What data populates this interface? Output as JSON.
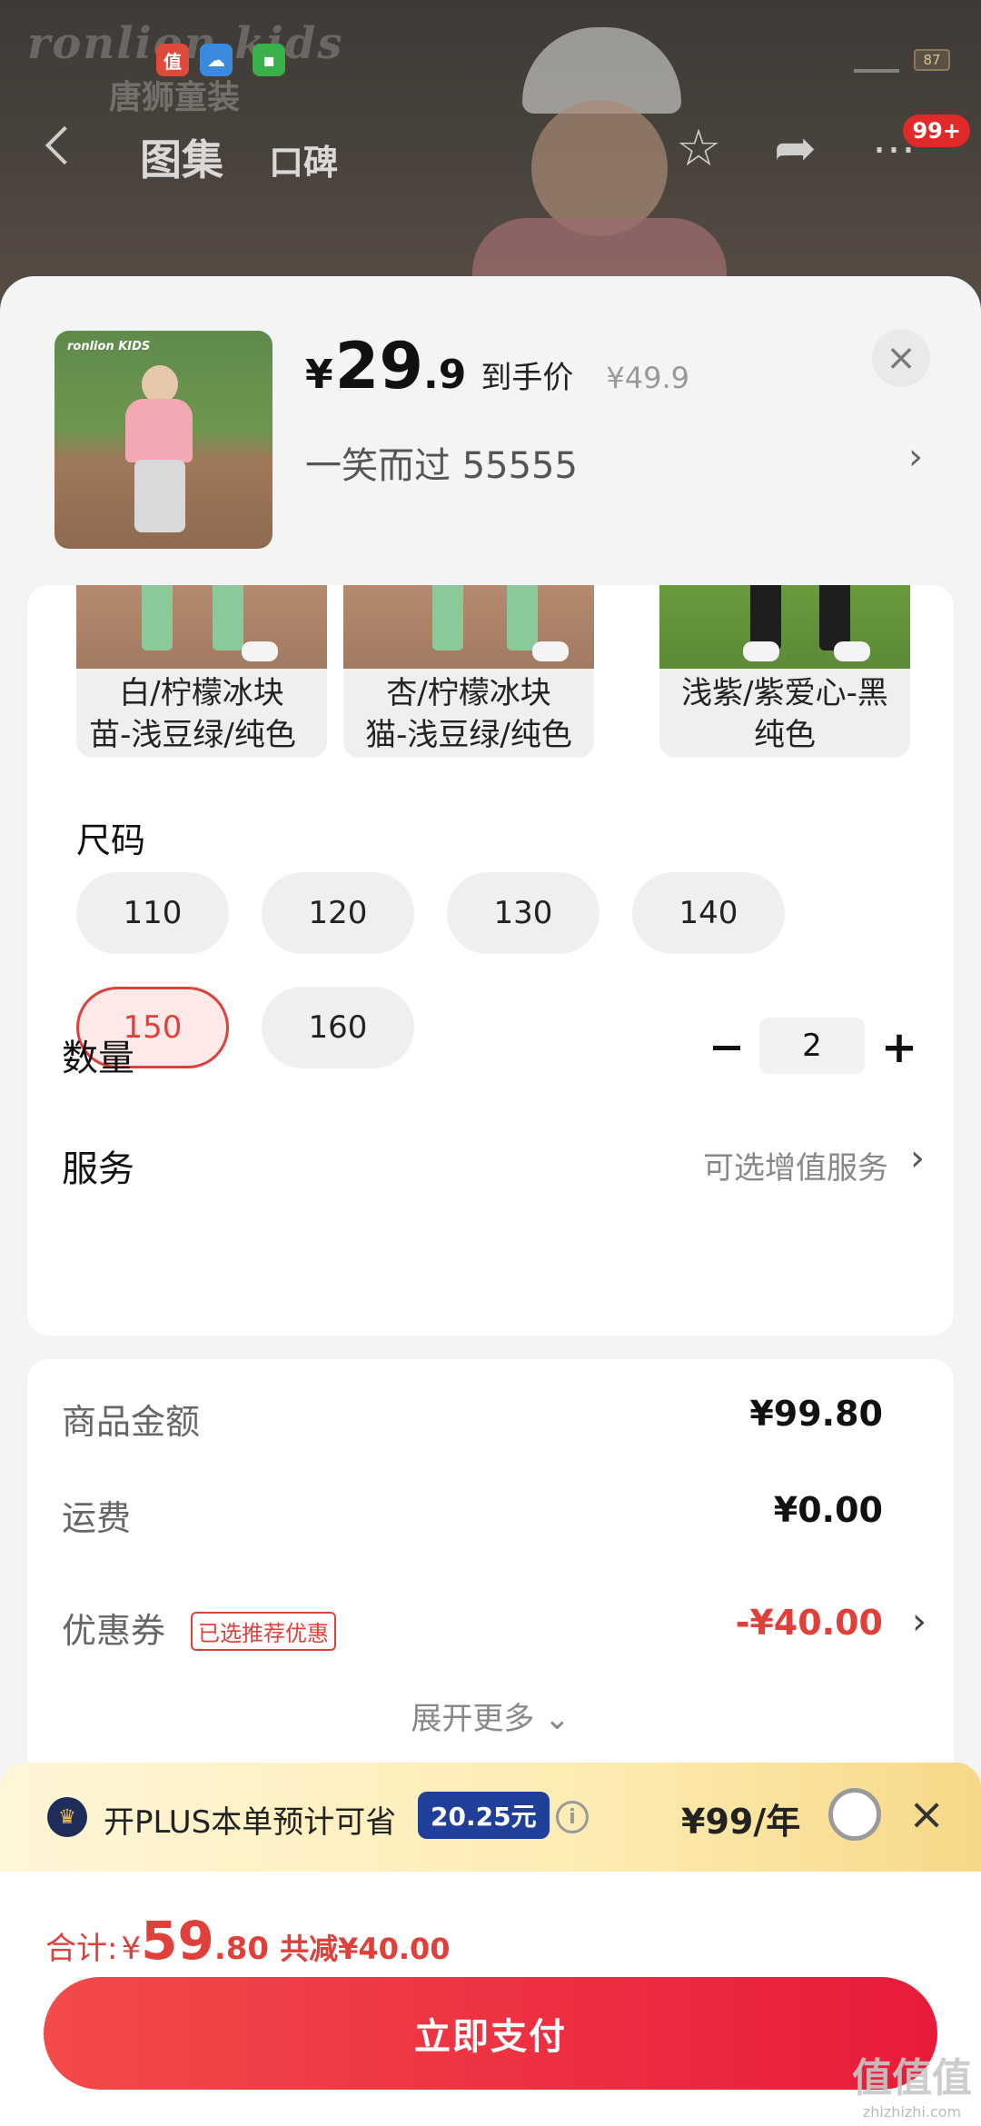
{
  "backdrop": {
    "brand": "ronlion kids",
    "brand_sub": "唐狮童装",
    "battery": "87",
    "nav_tabs": [
      "图集",
      "口碑"
    ],
    "badge": "99+"
  },
  "product": {
    "thumb_logo": "ronlion KIDS",
    "price_symbol": "¥",
    "price_int": "29",
    "price_dec": ".9",
    "price_tag": "到手价",
    "original_price": "¥49.9",
    "variant_text": "一笑而过  55555",
    "close_label": "×",
    "arrow": "›"
  },
  "colors": [
    {
      "label_line1": "白/柠檬冰块",
      "label_line2": "苗-浅豆绿/纯色"
    },
    {
      "label_line1": "杏/柠檬冰块",
      "label_line2": "猫-浅豆绿/纯色"
    },
    {
      "label_line1": "浅紫/紫爱心-黑",
      "label_line2": "纯色"
    }
  ],
  "size": {
    "title": "尺码",
    "options": [
      "110",
      "120",
      "130",
      "140",
      "150",
      "160"
    ],
    "selected": "150"
  },
  "quantity": {
    "label": "数量",
    "value": "2",
    "plus": "+"
  },
  "service": {
    "label": "服务",
    "value": "可选增值服务",
    "arrow": "›"
  },
  "price_summary": {
    "goods_label": "商品金额",
    "goods_value": "¥99.80",
    "shipping_label": "运费",
    "shipping_value": "¥0.00",
    "coupon_label": "优惠券",
    "coupon_tag": "已选推荐优惠",
    "coupon_value": "-¥40.00",
    "coupon_arrow": "›",
    "expand_more": "展开更多 ⌄"
  },
  "plus_banner": {
    "logo": "♛",
    "text": "开PLUS本单预计可省",
    "save": "20.25元",
    "info": "i",
    "price": "¥99/年",
    "close": "×"
  },
  "footer": {
    "total_label": "合计:",
    "total_symbol": "¥",
    "total_int": "59",
    "total_dec": ".80",
    "total_save": "共减¥40.00",
    "pay_button": "立即支付",
    "watermark_logo": "值值值",
    "watermark_url": "zhizhizhi.com"
  },
  "colors_theme": {
    "accent": "#e0403a",
    "plus_badge": "#1f3f9a"
  }
}
